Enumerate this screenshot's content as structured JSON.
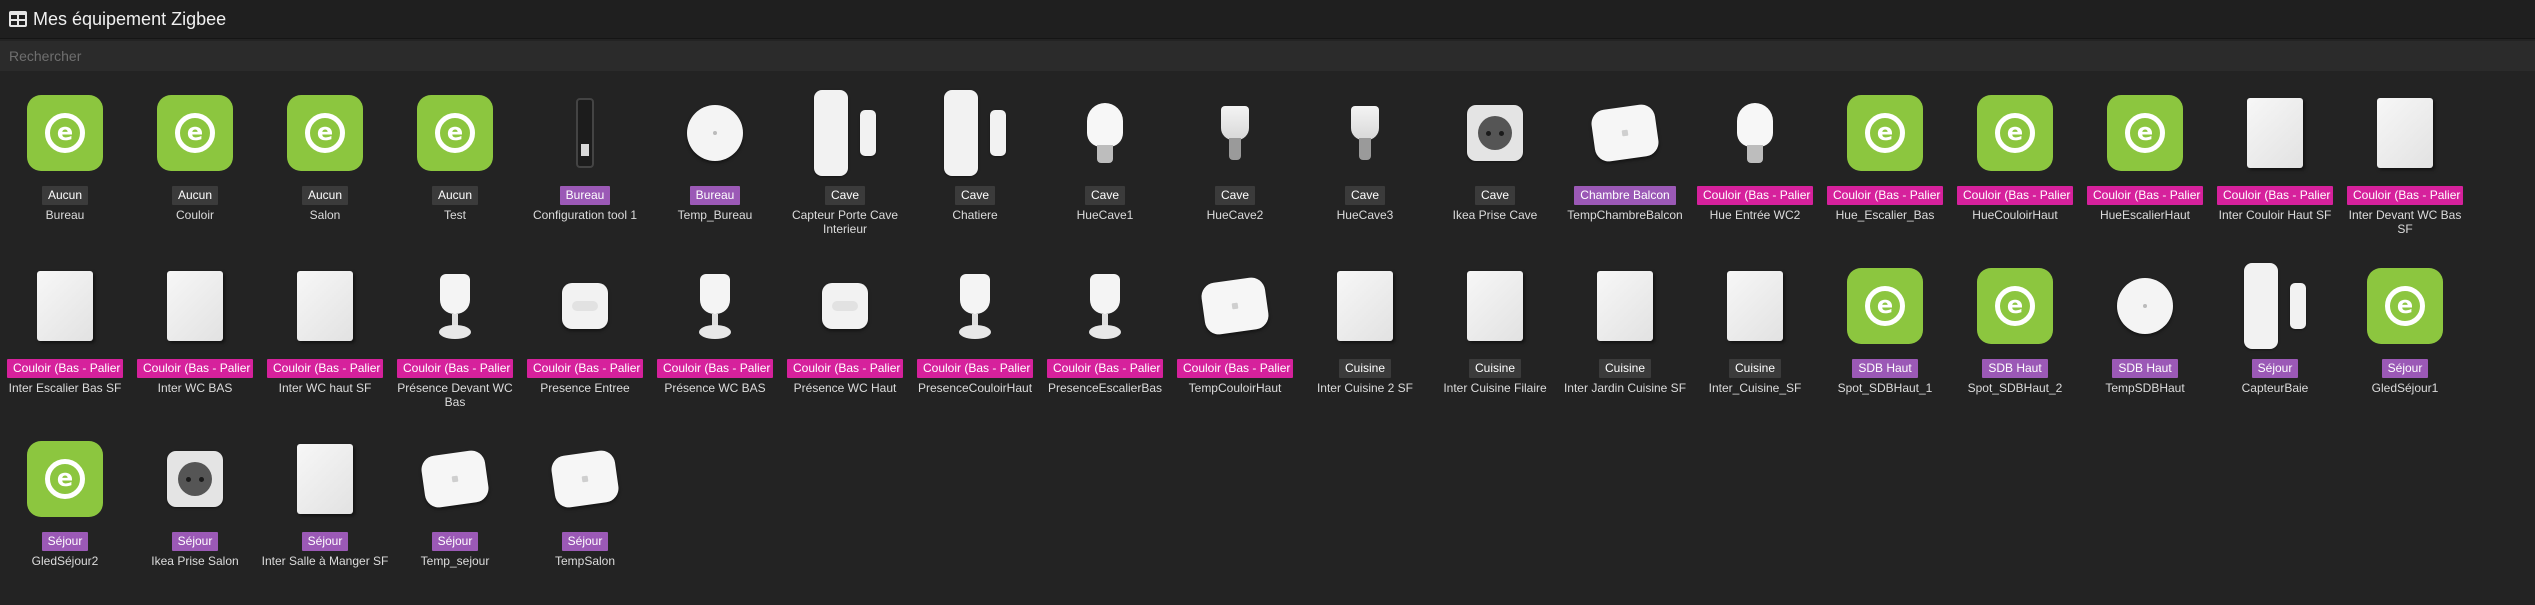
{
  "header": {
    "title": "Mes équipement Zigbee",
    "icon": "grid-icon"
  },
  "search": {
    "placeholder": "Rechercher",
    "value": ""
  },
  "colors": {
    "none_badge": "#3b3b3b",
    "purple_badge": "#9b59b6",
    "magenta_badge": "#d6219c",
    "eqlogic_green": "#8cc63f"
  },
  "devices": [
    {
      "name": "Bureau",
      "room": "Aucun",
      "badge": "none",
      "icon": "eqlogic-icon"
    },
    {
      "name": "Couloir",
      "room": "Aucun",
      "badge": "none",
      "icon": "eqlogic-icon"
    },
    {
      "name": "Salon",
      "room": "Aucun",
      "badge": "none",
      "icon": "eqlogic-icon"
    },
    {
      "name": "Test",
      "room": "Aucun",
      "badge": "none",
      "icon": "eqlogic-icon"
    },
    {
      "name": "Configuration tool 1",
      "room": "Bureau",
      "badge": "purple",
      "icon": "usb-stick-icon"
    },
    {
      "name": "Temp_Bureau",
      "room": "Bureau",
      "badge": "purple",
      "icon": "round-sensor-icon"
    },
    {
      "name": "Capteur Porte Cave Interieur",
      "room": "Cave",
      "badge": "none",
      "icon": "door-sensor-icon"
    },
    {
      "name": "Chatiere",
      "room": "Cave",
      "badge": "none",
      "icon": "door-sensor-icon"
    },
    {
      "name": "HueCave1",
      "room": "Cave",
      "badge": "none",
      "icon": "bulb-icon"
    },
    {
      "name": "HueCave2",
      "room": "Cave",
      "badge": "none",
      "icon": "spot-bulb-icon"
    },
    {
      "name": "HueCave3",
      "room": "Cave",
      "badge": "none",
      "icon": "spot-bulb-icon"
    },
    {
      "name": "Ikea Prise Cave",
      "room": "Cave",
      "badge": "none",
      "icon": "plug-icon"
    },
    {
      "name": "TempChambreBalcon",
      "room": "Chambre Balcon",
      "badge": "purple",
      "icon": "temp-sensor-icon"
    },
    {
      "name": "Hue Entrée WC2",
      "room": "Couloir (Bas - Palier -",
      "badge": "magenta",
      "icon": "bulb-icon"
    },
    {
      "name": "Hue_Escalier_Bas",
      "room": "Couloir (Bas - Palier -",
      "badge": "magenta",
      "icon": "eqlogic-icon"
    },
    {
      "name": "HueCouloirHaut",
      "room": "Couloir (Bas - Palier -",
      "badge": "magenta",
      "icon": "eqlogic-icon"
    },
    {
      "name": "HueEscalierHaut",
      "room": "Couloir (Bas - Palier -",
      "badge": "magenta",
      "icon": "eqlogic-icon"
    },
    {
      "name": "Inter Couloir Haut SF",
      "room": "Couloir (Bas - Palier -",
      "badge": "magenta",
      "icon": "wall-switch-icon"
    },
    {
      "name": "Inter Devant WC Bas SF",
      "room": "Couloir (Bas - Palier -",
      "badge": "magenta",
      "icon": "wall-switch-icon"
    },
    {
      "name": "Inter Escalier Bas SF",
      "room": "Couloir (Bas - Palier -",
      "badge": "magenta",
      "icon": "wall-switch-icon"
    },
    {
      "name": "Inter WC BAS",
      "room": "Couloir (Bas - Palier -",
      "badge": "magenta",
      "icon": "wall-switch-icon"
    },
    {
      "name": "Inter WC haut SF",
      "room": "Couloir (Bas - Palier -",
      "badge": "magenta",
      "icon": "wall-switch-icon"
    },
    {
      "name": "Présence Devant WC Bas",
      "room": "Couloir (Bas - Palier -",
      "badge": "magenta",
      "icon": "motion-sensor-icon"
    },
    {
      "name": "Presence Entree",
      "room": "Couloir (Bas - Palier -",
      "badge": "magenta",
      "icon": "cube-sensor-icon"
    },
    {
      "name": "Présence WC BAS",
      "room": "Couloir (Bas - Palier -",
      "badge": "magenta",
      "icon": "motion-sensor-icon"
    },
    {
      "name": "Présence WC Haut",
      "room": "Couloir (Bas - Palier -",
      "badge": "magenta",
      "icon": "cube-sensor-icon"
    },
    {
      "name": "PresenceCouloirHaut",
      "room": "Couloir (Bas - Palier -",
      "badge": "magenta",
      "icon": "motion-sensor-icon"
    },
    {
      "name": "PresenceEscalierBas",
      "room": "Couloir (Bas - Palier -",
      "badge": "magenta",
      "icon": "motion-sensor-icon"
    },
    {
      "name": "TempCouloirHaut",
      "room": "Couloir (Bas - Palier -",
      "badge": "magenta",
      "icon": "temp-sensor-icon"
    },
    {
      "name": "Inter Cuisine 2 SF",
      "room": "Cuisine",
      "badge": "none",
      "icon": "wall-switch-icon"
    },
    {
      "name": "Inter Cuisine Filaire",
      "room": "Cuisine",
      "badge": "none",
      "icon": "wall-switch-icon"
    },
    {
      "name": "Inter Jardin Cuisine SF",
      "room": "Cuisine",
      "badge": "none",
      "icon": "wall-switch-icon"
    },
    {
      "name": "Inter_Cuisine_SF",
      "room": "Cuisine",
      "badge": "none",
      "icon": "wall-switch-icon"
    },
    {
      "name": "Spot_SDBHaut_1",
      "room": "SDB Haut",
      "badge": "purple",
      "icon": "eqlogic-icon"
    },
    {
      "name": "Spot_SDBHaut_2",
      "room": "SDB Haut",
      "badge": "purple",
      "icon": "eqlogic-icon"
    },
    {
      "name": "TempSDBHaut",
      "room": "SDB Haut",
      "badge": "purple",
      "icon": "round-sensor-icon"
    },
    {
      "name": "CapteurBaie",
      "room": "Séjour",
      "badge": "purple",
      "icon": "door-sensor-icon"
    },
    {
      "name": "GledSéjour1",
      "room": "Séjour",
      "badge": "purple",
      "icon": "eqlogic-icon"
    },
    {
      "name": "GledSéjour2",
      "room": "Séjour",
      "badge": "purple",
      "icon": "eqlogic-icon"
    },
    {
      "name": "Ikea Prise Salon",
      "room": "Séjour",
      "badge": "purple",
      "icon": "plug-icon"
    },
    {
      "name": "Inter Salle à Manger SF",
      "room": "Séjour",
      "badge": "purple",
      "icon": "wall-switch-icon"
    },
    {
      "name": "Temp_sejour",
      "room": "Séjour",
      "badge": "purple",
      "icon": "temp-sensor-icon"
    },
    {
      "name": "TempSalon",
      "room": "Séjour",
      "badge": "purple",
      "icon": "temp-sensor-icon"
    }
  ]
}
